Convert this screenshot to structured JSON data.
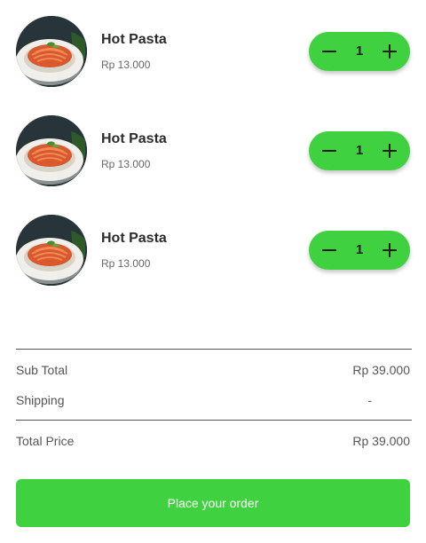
{
  "cart": {
    "items": [
      {
        "name": "Hot Pasta",
        "price": "Rp 13.000",
        "quantity": "1",
        "image": "pasta-photo"
      },
      {
        "name": "Hot Pasta",
        "price": "Rp 13.000",
        "quantity": "1",
        "image": "pasta-photo"
      },
      {
        "name": "Hot Pasta",
        "price": "Rp 13.000",
        "quantity": "1",
        "image": "pasta-photo"
      }
    ]
  },
  "summary": {
    "subtotal_label": "Sub Total",
    "subtotal_value": "Rp 39.000",
    "shipping_label": "Shipping",
    "shipping_value": "-",
    "total_label": "Total Price",
    "total_value": "Rp 39.000"
  },
  "actions": {
    "place_order_label": "Place your order"
  },
  "icons": {
    "decrement": "minus-icon",
    "increment": "plus-icon"
  },
  "colors": {
    "accent": "#3fd13f",
    "text_dark": "#2c2c2c",
    "text_muted": "#666666",
    "divider": "#555555"
  }
}
